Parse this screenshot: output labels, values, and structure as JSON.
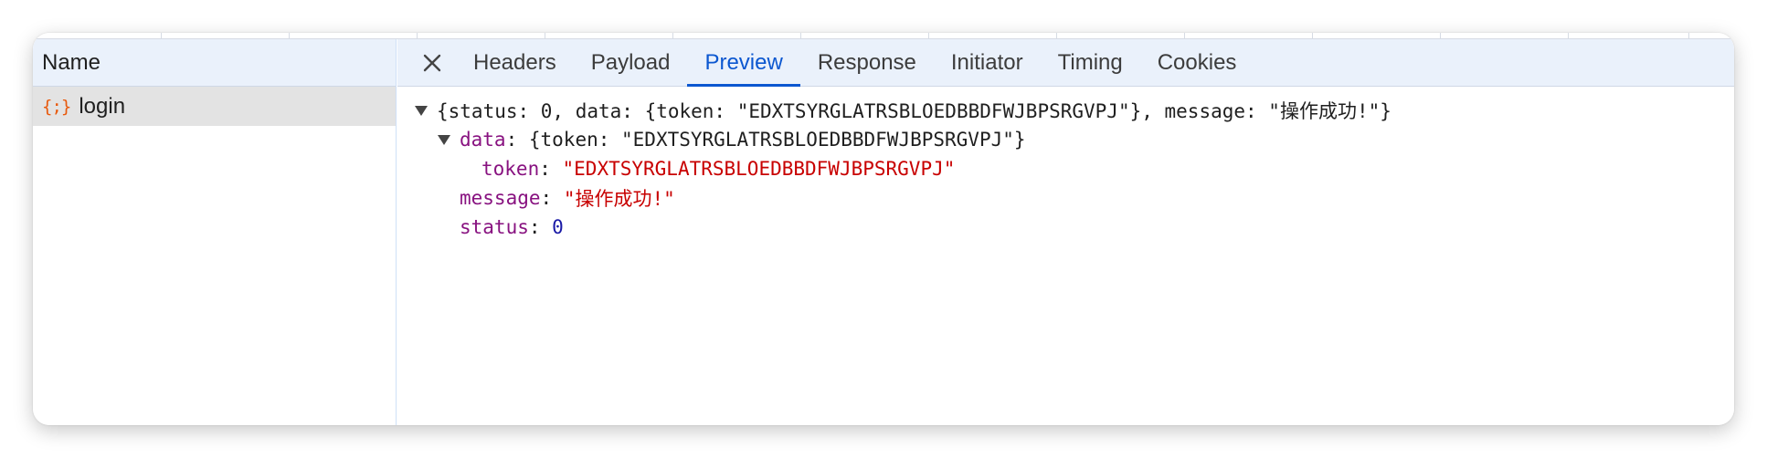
{
  "name_panel": {
    "header": "Name",
    "requests": [
      {
        "badge": "{;}",
        "name": "login"
      }
    ]
  },
  "tabs": {
    "items": [
      "Headers",
      "Payload",
      "Preview",
      "Response",
      "Initiator",
      "Timing",
      "Cookies"
    ],
    "active": "Preview"
  },
  "preview": {
    "summary": "{status: 0, data: {token: \"EDXTSYRGLATRSBLOEDBBDFWJBPSRGVPJ\"}, message: \"操作成功!\"}",
    "data_key": "data",
    "data_summary": "{token: \"EDXTSYRGLATRSBLOEDBBDFWJBPSRGVPJ\"}",
    "token_key": "token",
    "token_value": "\"EDXTSYRGLATRSBLOEDBBDFWJBPSRGVPJ\"",
    "message_key": "message",
    "message_value": "\"操作成功!\"",
    "status_key": "status",
    "status_value": "0",
    "colon": ": "
  },
  "colors": {
    "accent": "#0b57d0",
    "key": "#881280",
    "string": "#c80000",
    "number": "#1a1aa6",
    "json_badge": "#e8590c"
  },
  "icons": {
    "close": "close-icon",
    "expand": "triangle-down-icon",
    "json": "json-file-icon"
  }
}
